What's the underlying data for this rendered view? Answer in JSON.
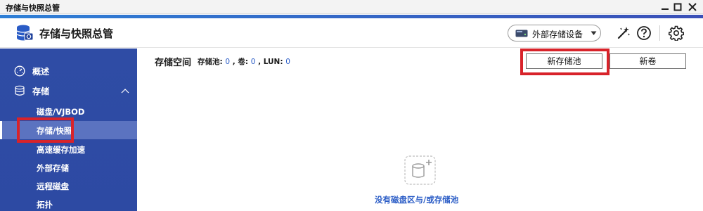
{
  "window": {
    "title": "存储与快照总管"
  },
  "header": {
    "app_title": "存储与快照总管",
    "external_device_button": "外部存储设备"
  },
  "sidebar": {
    "items": [
      {
        "label": "概述"
      },
      {
        "label": "存储"
      }
    ],
    "sub_items": [
      {
        "label": "磁盘/VJBOD"
      },
      {
        "label": "存储/快照"
      },
      {
        "label": "高速缓存加速"
      },
      {
        "label": "外部存储"
      },
      {
        "label": "远程磁盘"
      },
      {
        "label": "拓扑"
      }
    ],
    "active_item": "存储/快照"
  },
  "main": {
    "title": "存储空间",
    "stats": {
      "pool_label": "存储池:",
      "pool_count": "0",
      "volume_label": "卷:",
      "volume_count": "0",
      "lun_label": "LUN:",
      "lun_count": "0"
    },
    "buttons": {
      "new_pool": "新存储池",
      "new_volume": "新卷"
    },
    "empty_message": "没有磁盘区与/或存储池"
  },
  "colors": {
    "sidebar": "#2f4ca5",
    "sidebar_active": "#5b73c0",
    "accent_blue": "#2a5cc6",
    "highlight_red": "#d8232a"
  },
  "icons": {
    "app": "storage-snapshot-icon",
    "external": "external-disk-icon",
    "wand": "magic-wand-icon",
    "help": "help-icon",
    "settings": "gear-icon",
    "overview": "dashboard-icon",
    "storage": "database-icon",
    "empty": "add-disk-icon"
  }
}
